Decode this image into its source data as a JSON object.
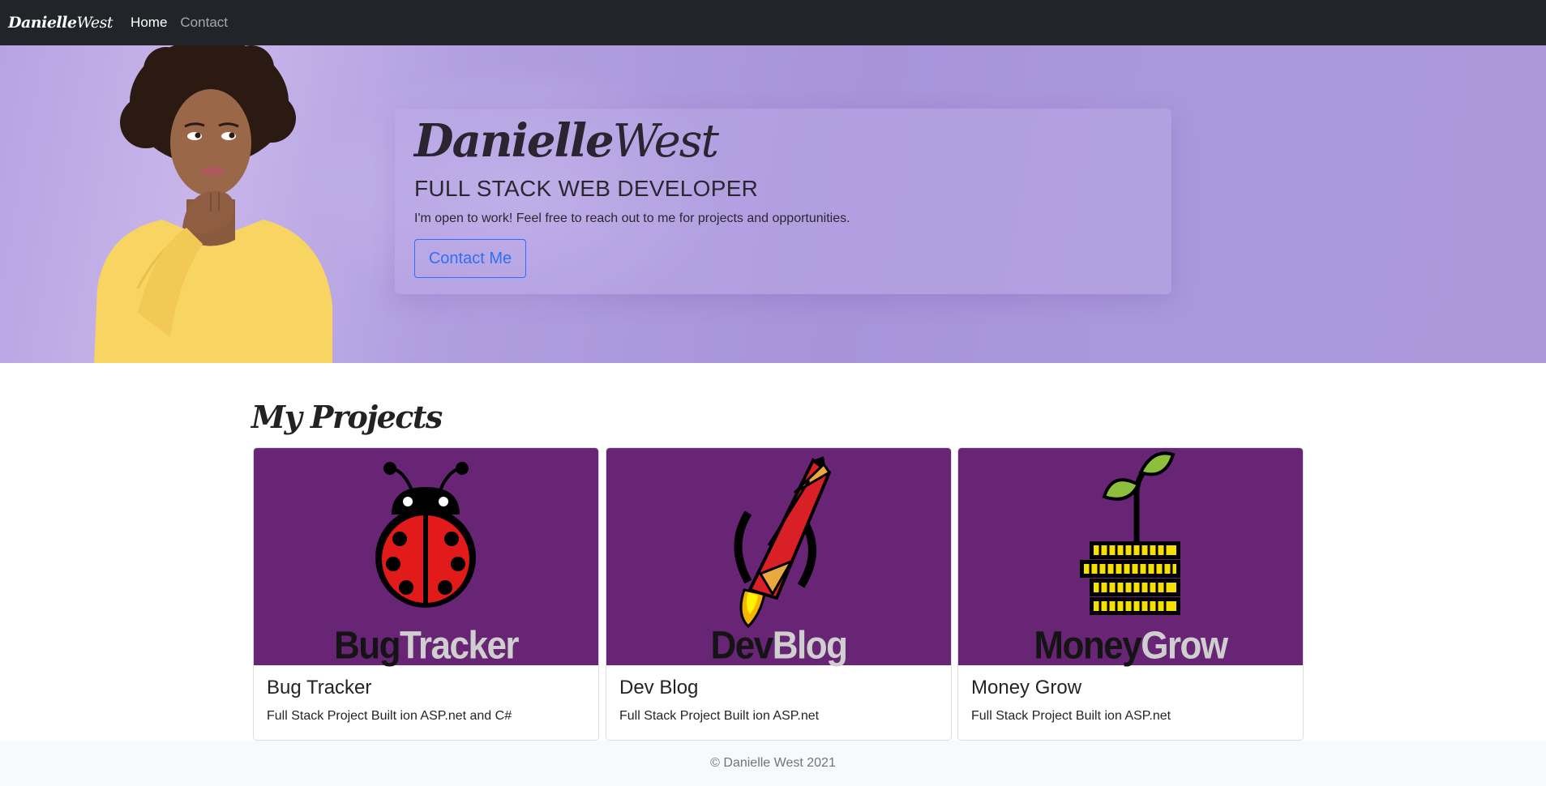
{
  "navbar": {
    "brand_first": "Danielle",
    "brand_last": "West",
    "links": [
      {
        "label": "Home",
        "active": true
      },
      {
        "label": "Contact",
        "active": false
      }
    ]
  },
  "hero": {
    "name_first": "Danielle",
    "name_last": "West",
    "title": "FULL STACK WEB DEVELOPER",
    "text": "I'm open to work! Feel free to reach out to me for projects and opportunities.",
    "button_label": "Contact Me"
  },
  "projects": {
    "heading": "My Projects",
    "items": [
      {
        "image_caption_a": "Bug",
        "image_caption_b": "Tracker",
        "icon": "ladybug-icon",
        "title": "Bug Tracker",
        "text": "Full Stack Project Built ion ASP.net and C#"
      },
      {
        "image_caption_a": "Dev",
        "image_caption_b": "Blog",
        "icon": "pencil-rocket-icon",
        "title": "Dev Blog",
        "text": "Full Stack Project Built ion ASP.net"
      },
      {
        "image_caption_a": "Money",
        "image_caption_b": "Grow",
        "icon": "coin-plant-icon",
        "title": "Money Grow",
        "text": "Full Stack Project Built ion ASP.net"
      }
    ]
  },
  "footer": {
    "text": "© Danielle West 2021"
  },
  "colors": {
    "navbar": "#212529",
    "hero_purple": "#ab98dc",
    "project_purple": "#692575",
    "button_blue": "#2f6ef5",
    "footer": "#f8f9fa"
  }
}
